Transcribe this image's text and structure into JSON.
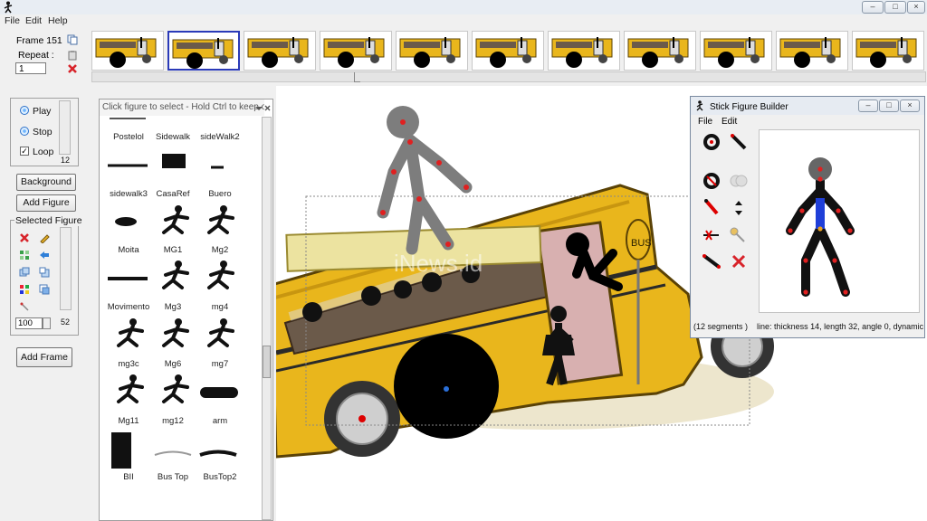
{
  "menu": {
    "file": "File",
    "edit": "Edit",
    "help": "Help"
  },
  "frame": {
    "label": "Frame 151",
    "repeat_label": "Repeat :",
    "repeat_value": "1"
  },
  "playback": {
    "play": "Play",
    "stop": "Stop",
    "loop": "Loop",
    "loop_checked": true,
    "scroll_value": "12"
  },
  "buttons": {
    "background": "Background",
    "add_figure": "Add Figure",
    "add_frame": "Add Frame"
  },
  "selected_figure": {
    "title": "Selected Figure",
    "size_value": "100",
    "scroll_value": "52"
  },
  "library": {
    "title": "Click figure to select - Hold Ctrl to keep op...",
    "figures": [
      "Postelol",
      "Sidewalk",
      "sideWalk2",
      "sidewalk3",
      "CasaRef",
      "Buero",
      "Moita",
      "MG1",
      "Mg2",
      "Movimento",
      "Mg3",
      "mg4",
      "mg3c",
      "Mg6",
      "mg7",
      "Mg11",
      "mg12",
      "arm",
      "BII",
      "Bus Top",
      "BusTop2"
    ]
  },
  "canvas": {
    "bus_sign": "BUS",
    "watermark": "iNews.id"
  },
  "builder": {
    "title": "Stick Figure Builder",
    "menu_file": "File",
    "menu_edit": "Edit",
    "status_segments": "(12 segments )",
    "status_details": "line: thickness 14, length 32, angle 0, dynamic"
  },
  "window_buttons": {
    "minimize": "–",
    "maximize": "□",
    "close": "×"
  }
}
